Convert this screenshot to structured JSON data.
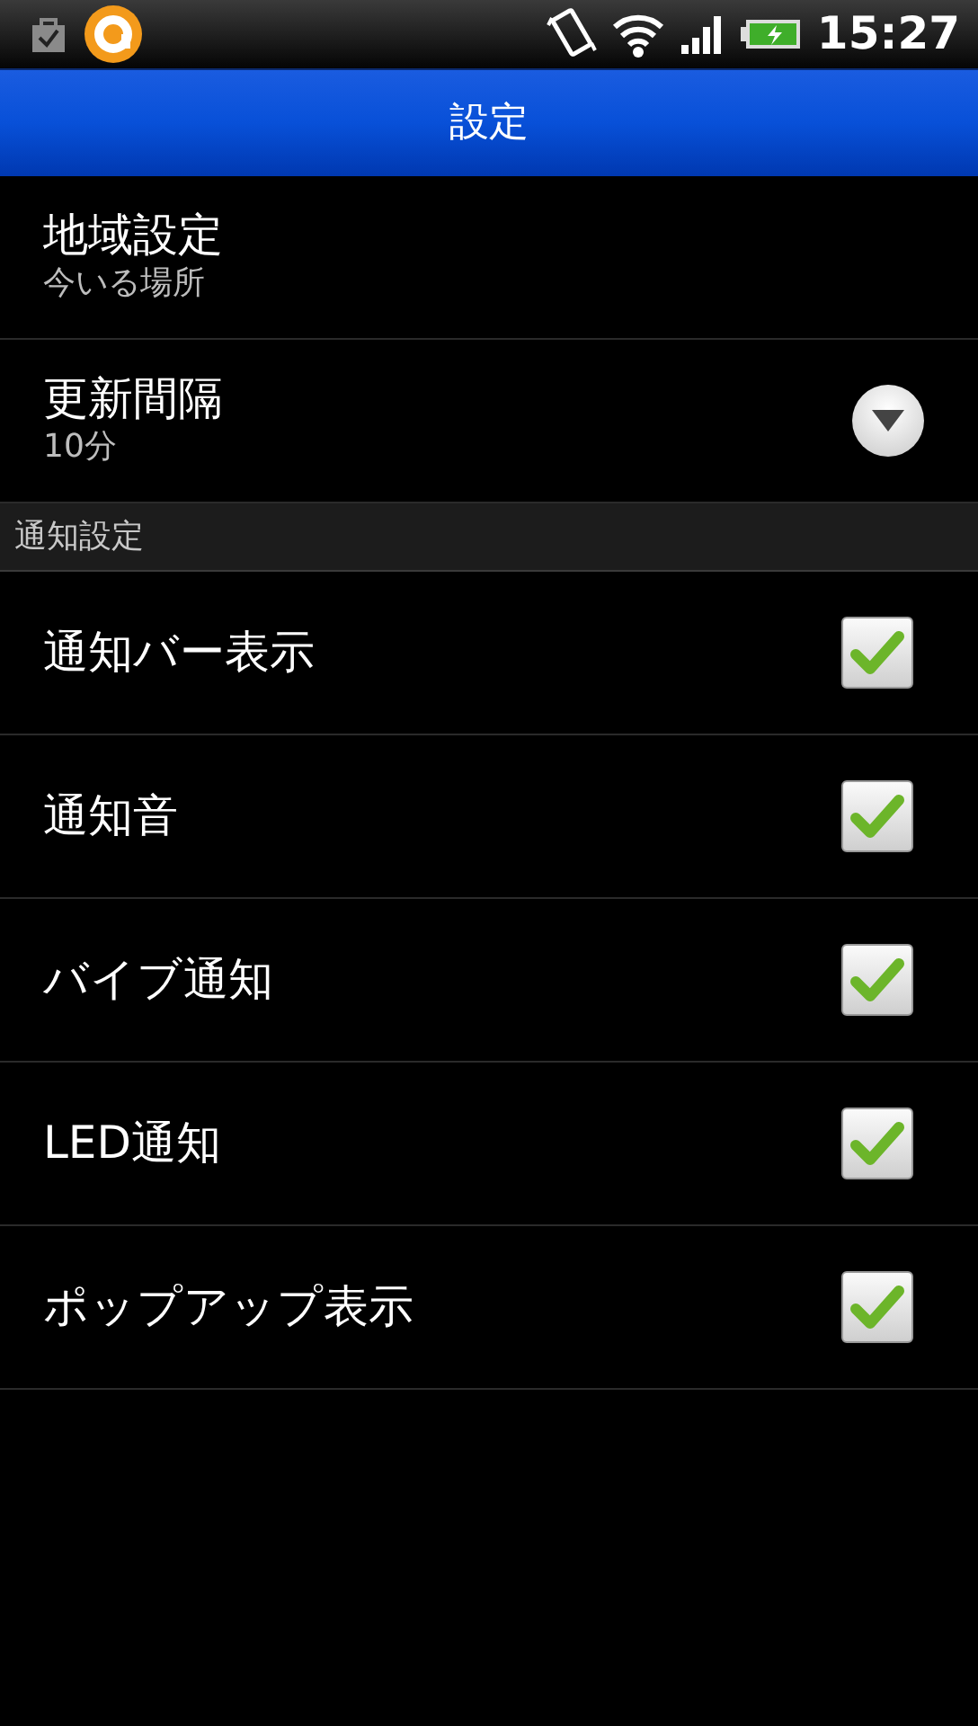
{
  "status_bar": {
    "time": "15:27"
  },
  "title_bar": {
    "title": "設定"
  },
  "items": [
    {
      "kind": "text",
      "title": "地域設定",
      "summary": "今いる場所"
    },
    {
      "kind": "dropdown",
      "title": "更新間隔",
      "summary": "10分"
    },
    {
      "kind": "section",
      "title": "通知設定"
    },
    {
      "kind": "checkbox",
      "title": "通知バー表示",
      "checked": true
    },
    {
      "kind": "checkbox",
      "title": "通知音",
      "checked": true
    },
    {
      "kind": "checkbox",
      "title": "バイブ通知",
      "checked": true
    },
    {
      "kind": "checkbox",
      "title": "LED通知",
      "checked": true
    },
    {
      "kind": "checkbox",
      "title": "ポップアップ表示",
      "checked": true
    }
  ]
}
